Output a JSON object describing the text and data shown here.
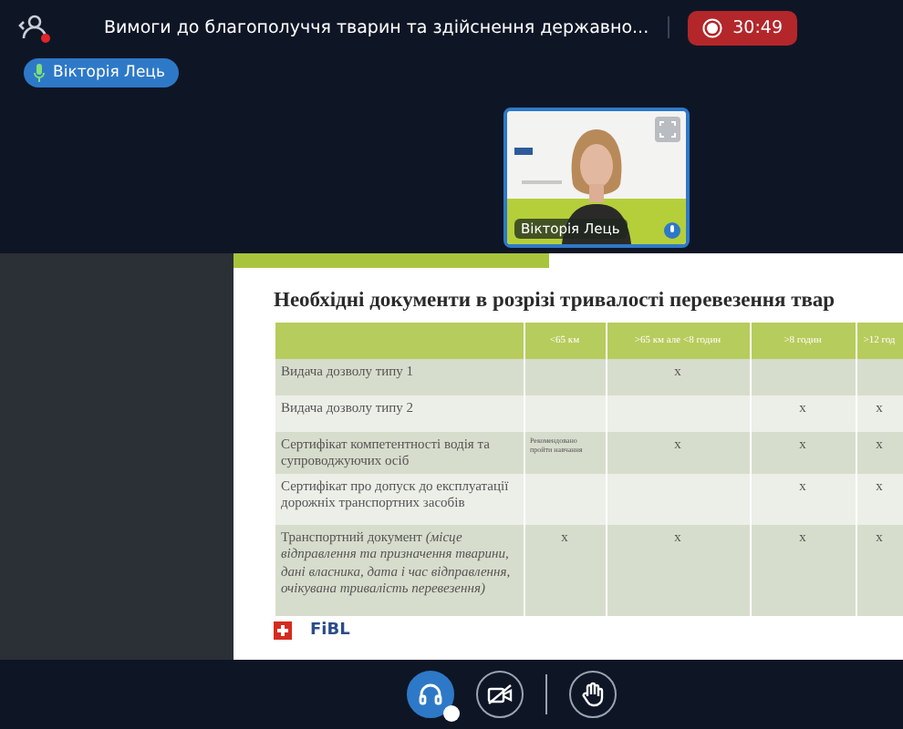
{
  "meeting": {
    "title": "Вимоги до благополуччя тварин та здійснення державно...",
    "timer": "30:49",
    "recording": true
  },
  "speaker_badge": {
    "name": "Вікторія Лець"
  },
  "video_tile": {
    "name": "Вікторія Лець"
  },
  "slide": {
    "title": "Необхідні документи в розрізі тривалості перевезення твар",
    "columns": [
      "<65 км",
      ">65 км але <8 годин",
      ">8 годин",
      ">12 год"
    ],
    "rows": [
      {
        "label": "Видача дозволу типу 1",
        "cells": [
          "",
          "x",
          "",
          ""
        ]
      },
      {
        "label": "Видача дозволу типу 2",
        "cells": [
          "",
          "",
          "x",
          "x"
        ]
      },
      {
        "label": "Сертифікат компетентності водія та супроводжуючих осіб",
        "cells": [
          "Рекомендовано пройти навчання",
          "x",
          "x",
          "x"
        ]
      },
      {
        "label": "Сертифікат про допуск до експлуатації дорожніх транспортних засобів",
        "cells": [
          "",
          "",
          "x",
          "x"
        ]
      },
      {
        "label": "Транспортний документ *(місце відправлення та призначення тварини, дані власника, дата і час відправлення, очікувана тривалість перевезення)*",
        "cells": [
          "x",
          "x",
          "x",
          "x"
        ]
      }
    ],
    "footer_logo": "FiBL"
  },
  "controls": [
    {
      "kind": "audio",
      "on": true
    },
    {
      "kind": "camera",
      "on": false
    },
    {
      "kind": "hand",
      "on": false
    }
  ]
}
